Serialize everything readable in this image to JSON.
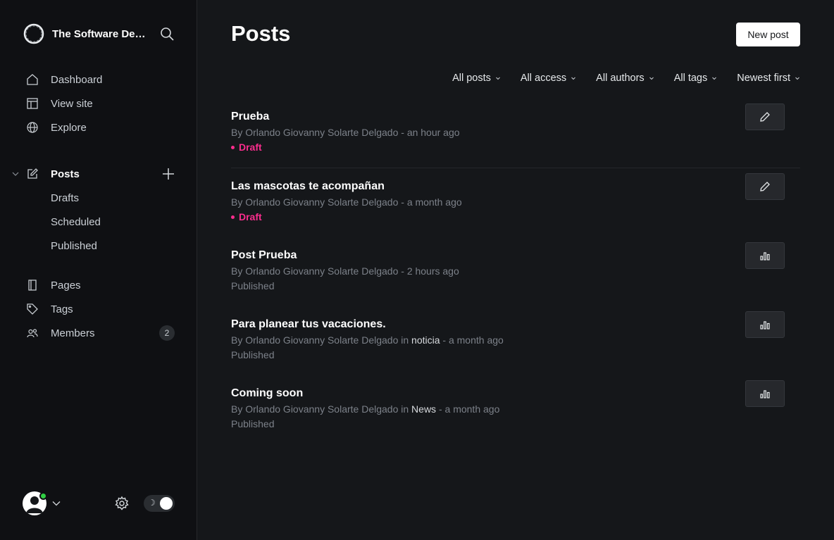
{
  "sidebar": {
    "brand_name": "The Software Development Blog",
    "nav_top": [
      {
        "label": "Dashboard",
        "icon": "home-icon"
      },
      {
        "label": "View site",
        "icon": "layout-icon"
      },
      {
        "label": "Explore",
        "icon": "globe-icon"
      }
    ],
    "posts_label": "Posts",
    "posts_sub": [
      "Drafts",
      "Scheduled",
      "Published"
    ],
    "nav_bottom": [
      {
        "label": "Pages",
        "icon": "page-icon"
      },
      {
        "label": "Tags",
        "icon": "tag-icon"
      },
      {
        "label": "Members",
        "icon": "members-icon",
        "badge": "2"
      }
    ]
  },
  "header": {
    "title": "Posts",
    "new_post_label": "New post"
  },
  "filters": [
    "All posts",
    "All access",
    "All authors",
    "All tags",
    "Newest first"
  ],
  "posts": [
    {
      "title": "Prueba",
      "author": "By Orlando Giovanny Solarte Delgado",
      "tag": "",
      "time": "an hour ago",
      "status": "Draft",
      "action": "edit-icon"
    },
    {
      "title": "Las mascotas te acompañan",
      "author": "By Orlando Giovanny Solarte Delgado",
      "tag": "",
      "time": "a month ago",
      "status": "Draft",
      "action": "edit-icon"
    },
    {
      "title": "Post Prueba",
      "author": "By Orlando Giovanny Solarte Delgado",
      "tag": "",
      "time": "2 hours ago",
      "status": "Published",
      "action": "analytics-icon"
    },
    {
      "title": "Para planear tus vacaciones.",
      "author": "By Orlando Giovanny Solarte Delgado",
      "tag": "noticia",
      "time": "a month ago",
      "status": "Published",
      "action": "analytics-icon"
    },
    {
      "title": "Coming soon",
      "author": "By Orlando Giovanny Solarte Delgado",
      "tag": "News",
      "time": "a month ago",
      "status": "Published",
      "action": "analytics-icon"
    }
  ],
  "meta_words": {
    "in": "in",
    "sep": "-"
  },
  "colors": {
    "accent_draft": "#fb2d8d",
    "online": "#30cf43",
    "background": "#15171a"
  }
}
